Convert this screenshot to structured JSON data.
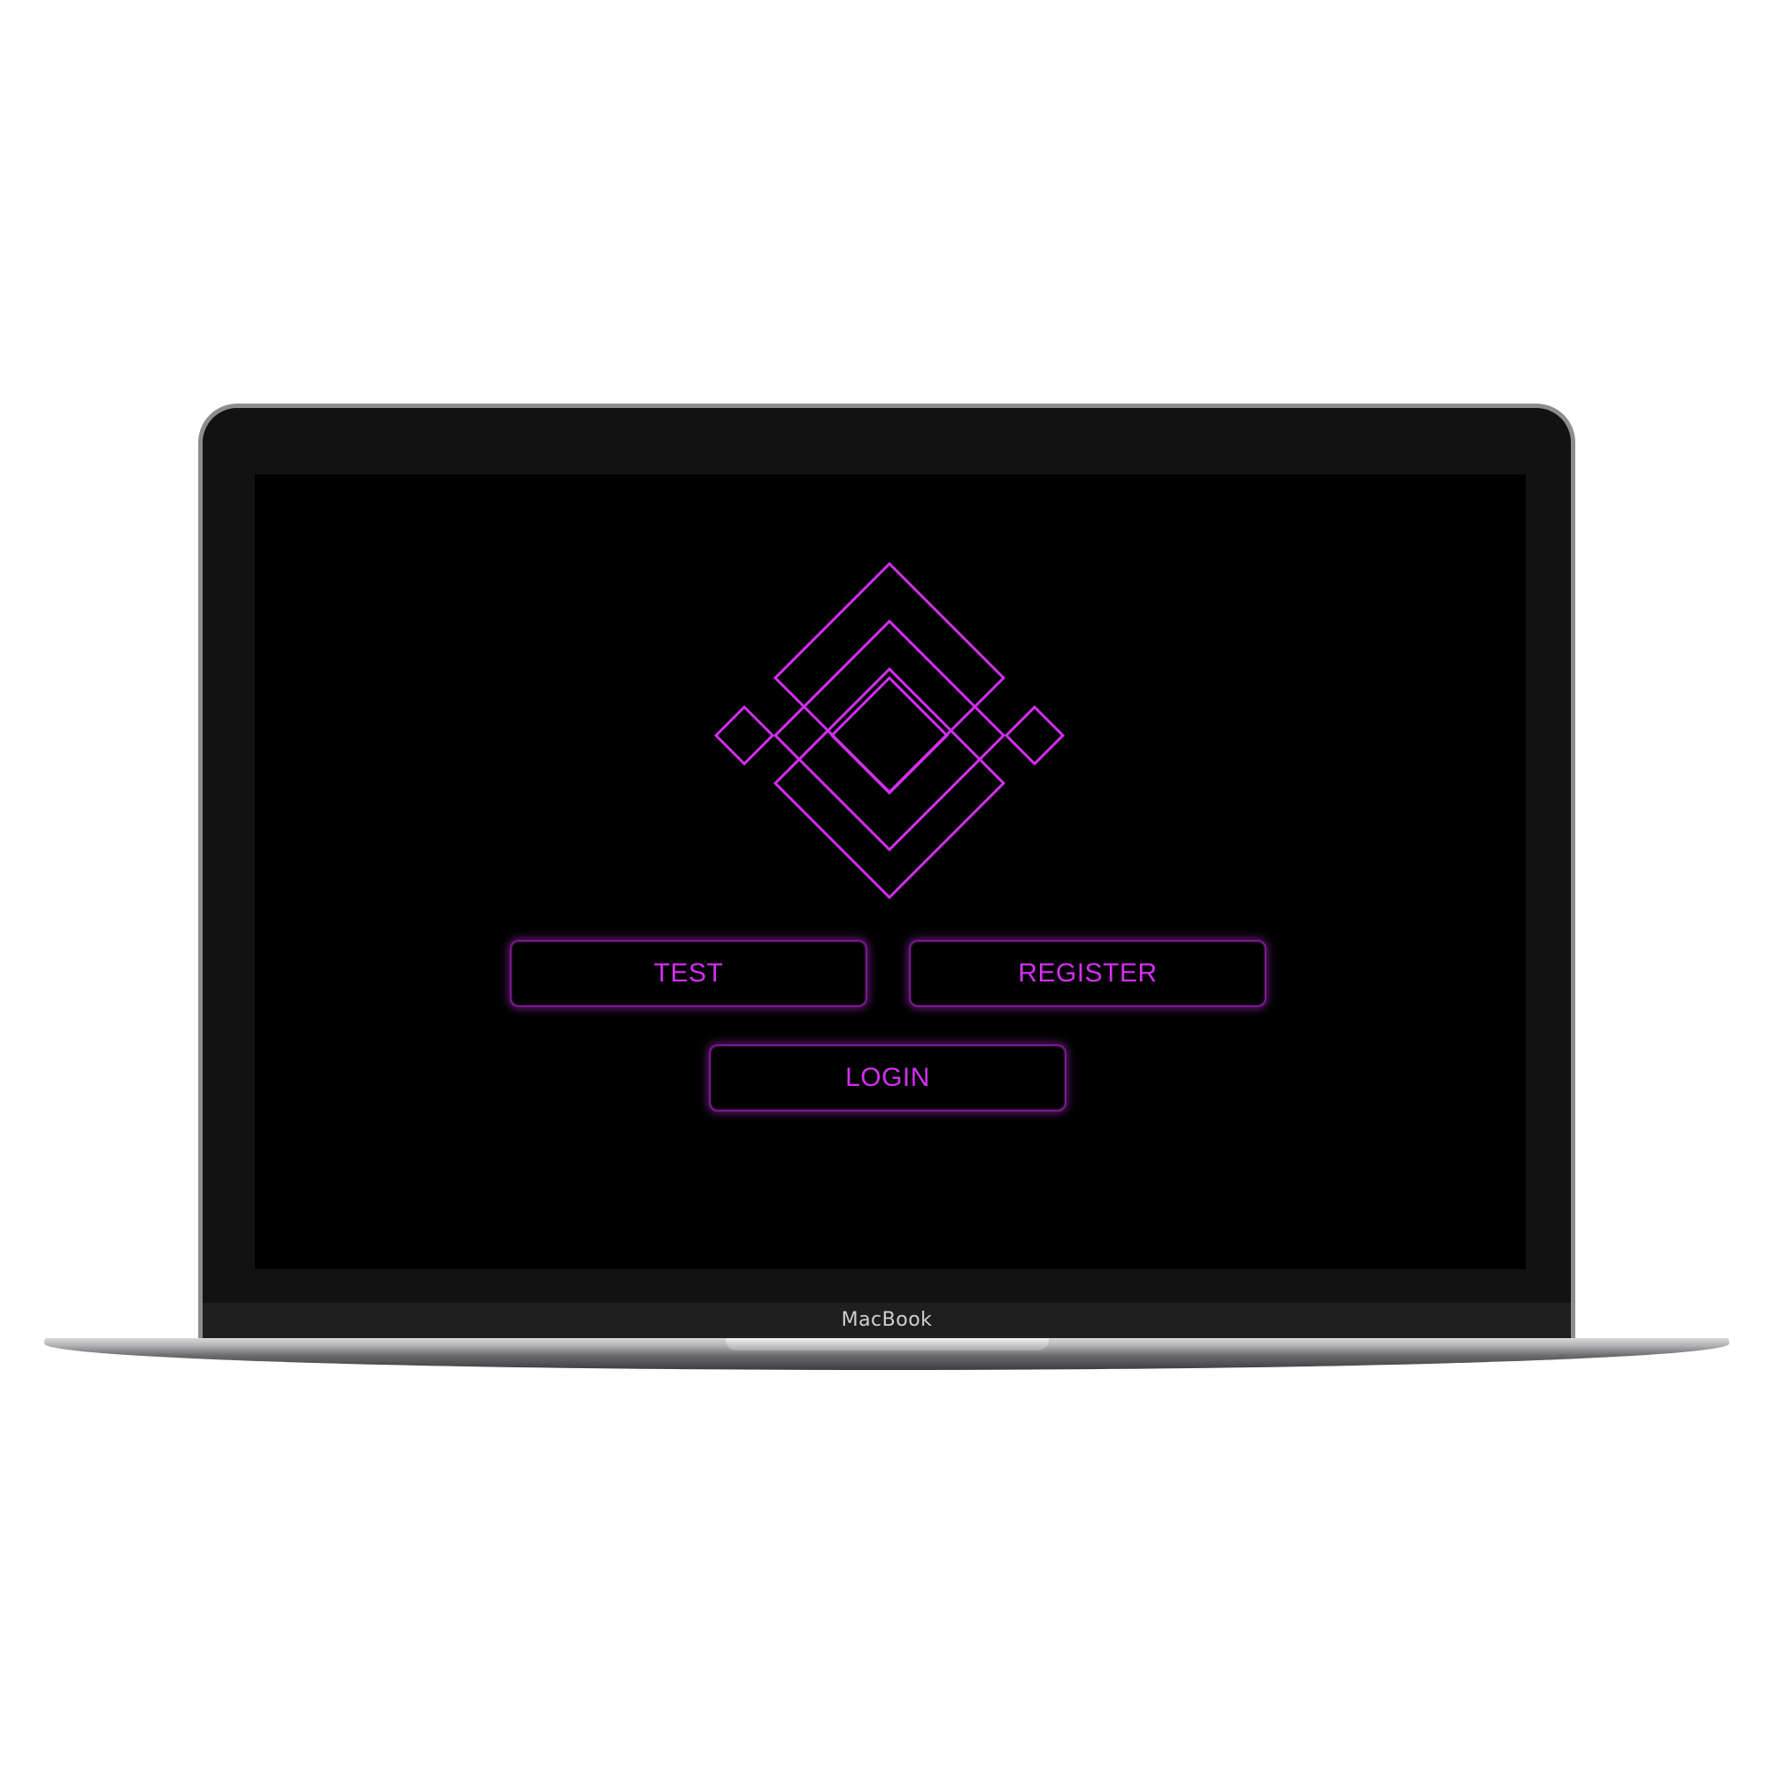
{
  "device": {
    "brand_label": "MacBook"
  },
  "app": {
    "accent_color": "#d22fef",
    "background_color": "#000000",
    "logo_icon": "geometric-diamond-logo",
    "buttons": {
      "test_label": "TEST",
      "register_label": "REGISTER",
      "login_label": "LOGIN"
    }
  }
}
